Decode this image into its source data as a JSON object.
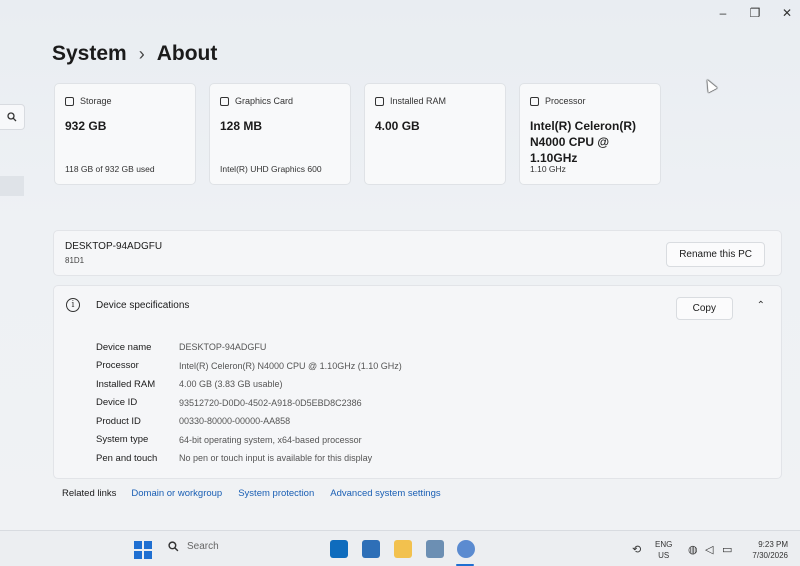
{
  "window": {
    "minimize_glyph": "‒",
    "maximize_glyph": "❐",
    "close_glyph": "✕"
  },
  "breadcrumb": {
    "parent": "System",
    "separator": "›",
    "current": "About"
  },
  "cards": [
    {
      "icon": "storage-icon",
      "label": "Storage",
      "value": "932 GB",
      "sub": "118 GB of 932 GB used"
    },
    {
      "icon": "graphics-card-icon",
      "label": "Graphics Card",
      "value": "128 MB",
      "sub": "Intel(R) UHD Graphics 600"
    },
    {
      "icon": "ram-icon",
      "label": "Installed RAM",
      "value": "4.00 GB",
      "sub": ""
    },
    {
      "icon": "processor-icon",
      "label": "Processor",
      "value": "Intel(R) Celeron(R) N4000 CPU @ 1.10GHz",
      "sub": "1.10 GHz"
    }
  ],
  "pc": {
    "name": "DESKTOP-94ADGFU",
    "model": "81D1",
    "rename_label": "Rename this PC"
  },
  "specs": {
    "title": "Device specifications",
    "copy_label": "Copy",
    "collapse_glyph": "⌃",
    "info_glyph": "i",
    "rows": [
      {
        "label": "Device name",
        "value": "DESKTOP-94ADGFU"
      },
      {
        "label": "Processor",
        "value": "Intel(R) Celeron(R) N4000 CPU @ 1.10GHz (1.10 GHz)"
      },
      {
        "label": "Installed RAM",
        "value": "4.00 GB (3.83 GB usable)"
      },
      {
        "label": "Device ID",
        "value": "93512720-D0D0-4502-A918-0D5EBD8C2386"
      },
      {
        "label": "Product ID",
        "value": "00330-80000-00000-AA858"
      },
      {
        "label": "System type",
        "value": "64-bit operating system, x64-based processor"
      },
      {
        "label": "Pen and touch",
        "value": "No pen or touch input is available for this display"
      }
    ]
  },
  "related": {
    "label": "Related links",
    "links": [
      "Domain or workgroup",
      "System protection",
      "Advanced system settings"
    ]
  },
  "taskbar": {
    "search_placeholder": "Search",
    "lang_line1": "ENG",
    "lang_line2": "US",
    "time": "9:23 PM",
    "date": "7/30/2026"
  },
  "colors": {
    "accent": "#1f6fd1",
    "link": "#1a5fb4"
  }
}
